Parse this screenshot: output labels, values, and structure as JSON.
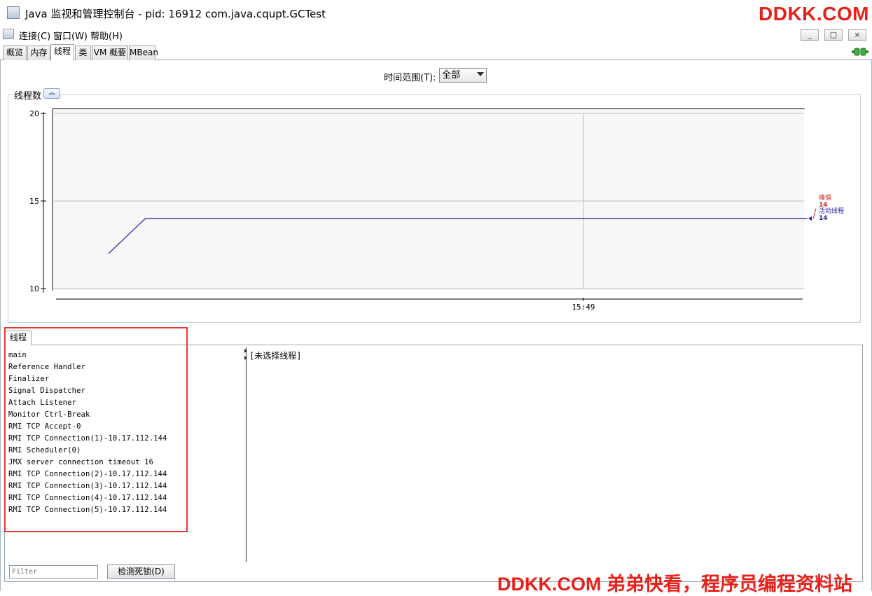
{
  "window": {
    "title": "Java 监视和管理控制台 - pid: 16912 com.java.cqupt.GCTest",
    "controls": {
      "minimize": "_",
      "restore": "□",
      "close": "×"
    }
  },
  "watermarks": {
    "top": "DDKK.COM",
    "bottom": "DDKK.COM 弟弟快看，程序员编程资料站"
  },
  "menu": [
    "连接(C)",
    "窗口(W)",
    "帮助(H)"
  ],
  "tabs": [
    "概览",
    "内存",
    "线程",
    "类",
    "VM 概要",
    "MBean"
  ],
  "selected_tab": "线程",
  "time_range": {
    "label": "时间范围(T):",
    "value": "全部"
  },
  "chart_section": {
    "title": "线程数",
    "collapse_icon": "double-chevron-up-icon"
  },
  "chart_data": {
    "type": "line",
    "title": "",
    "xlabel": "",
    "ylabel": "",
    "ylim": [
      10,
      20
    ],
    "yticks": [
      10,
      15,
      20
    ],
    "xtick_labels": [
      "15:49"
    ],
    "grid": true,
    "series": [
      {
        "name": "峰值",
        "color": "#d62020",
        "points": []
      },
      {
        "name": "活动线程",
        "color": "#1a1aa0",
        "points": [
          {
            "t": 0,
            "y": 12
          },
          {
            "t": 1,
            "y": 14
          },
          {
            "t": 19,
            "y": 14
          }
        ]
      }
    ],
    "legend": [
      {
        "label": "峰值",
        "value": "14",
        "color": "#d62020"
      },
      {
        "label": "活动线程",
        "value": "14",
        "color": "#1a1aa0"
      }
    ],
    "legend_position": "right"
  },
  "threads": {
    "tab_label": "线程",
    "items": [
      "main",
      "Reference Handler",
      "Finalizer",
      "Signal Dispatcher",
      "Attach Listener",
      "Monitor Ctrl-Break",
      "RMI TCP Accept-0",
      "RMI TCP Connection(1)-10.17.112.144",
      "RMI Scheduler(0)",
      "JMX server connection timeout 16",
      "RMI TCP Connection(2)-10.17.112.144",
      "RMI TCP Connection(3)-10.17.112.144",
      "RMI TCP Connection(4)-10.17.112.144",
      "RMI TCP Connection(5)-10.17.112.144"
    ],
    "detail": "[未选择线程]",
    "filter_placeholder": "Filter",
    "detect_deadlock_label": "检测死锁(D)"
  }
}
